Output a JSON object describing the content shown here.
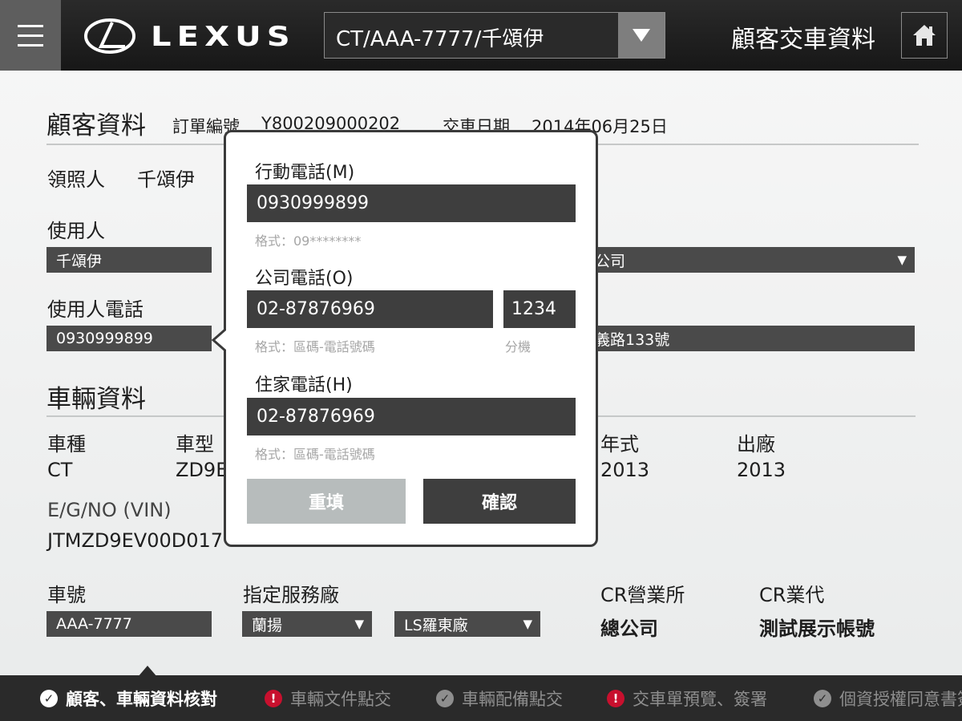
{
  "header": {
    "logo_text": "LEXUS",
    "vehicle_selector": "CT/AAA-7777/千頌伊",
    "page_title": "顧客交車資料"
  },
  "customer": {
    "section_title": "顧客資料",
    "order_label": "訂單編號",
    "order_no": "Y800209000202",
    "delivery_label": "交車日期",
    "delivery_date": "2014年06月25日",
    "licensee_label": "領照人",
    "licensee_value": "千頌伊",
    "user_label": "使用人",
    "user_value": "千頌伊",
    "user_phone_label": "使用人電話",
    "user_phone_value": "0930999899",
    "right_field_1": "公司",
    "right_field_2": "義路133號"
  },
  "vehicle": {
    "section_title": "車輛資料",
    "kind_label": "車種",
    "kind_value": "CT",
    "model_label": "車型",
    "model_value": "ZD9E",
    "year_label": "年式",
    "year_value": "2013",
    "factory_label": "出廠",
    "factory_value": "2013",
    "vin_label": "E/G/NO (VIN)",
    "vin_value": "JTMZD9EV00D017",
    "plate_label": "車號",
    "plate_value": "AAA-7777",
    "service_label": "指定服務廠",
    "service_select_1": "蘭揚",
    "service_select_2": "LS羅東廠",
    "cr_office_label": "CR營業所",
    "cr_office_value": "總公司",
    "cr_agent_label": "CR業代",
    "cr_agent_value": "測試展示帳號"
  },
  "popup": {
    "mobile_label": "行動電話(M)",
    "mobile_value": "0930999899",
    "mobile_hint": "格式：09********",
    "office_label": "公司電話(O)",
    "office_value": "02-87876969",
    "office_ext": "1234",
    "office_hint": "格式：區碼-電話號碼",
    "ext_hint": "分機",
    "home_label": "住家電話(H)",
    "home_value": "02-87876969",
    "home_hint": "格式：區碼-電話號碼",
    "reset_label": "重填",
    "confirm_label": "確認"
  },
  "steps": [
    {
      "label": "顧客、車輛資料核對",
      "status": "done-active"
    },
    {
      "label": "車輛文件點交",
      "status": "warning"
    },
    {
      "label": "車輛配備點交",
      "status": "done"
    },
    {
      "label": "交車單預覽、簽署",
      "status": "warning"
    },
    {
      "label": "個資授權同意書簽",
      "status": "done"
    }
  ],
  "colors": {
    "topbar": "#1f1f1f",
    "field_bg": "#4a4a4a",
    "warning": "#c8102e",
    "reset_btn": "#b7bcbc"
  },
  "icons": [
    "menu-icon",
    "lexus-logo-icon",
    "dropdown-arrow-icon",
    "home-icon",
    "check-circle-icon",
    "warning-icon"
  ]
}
